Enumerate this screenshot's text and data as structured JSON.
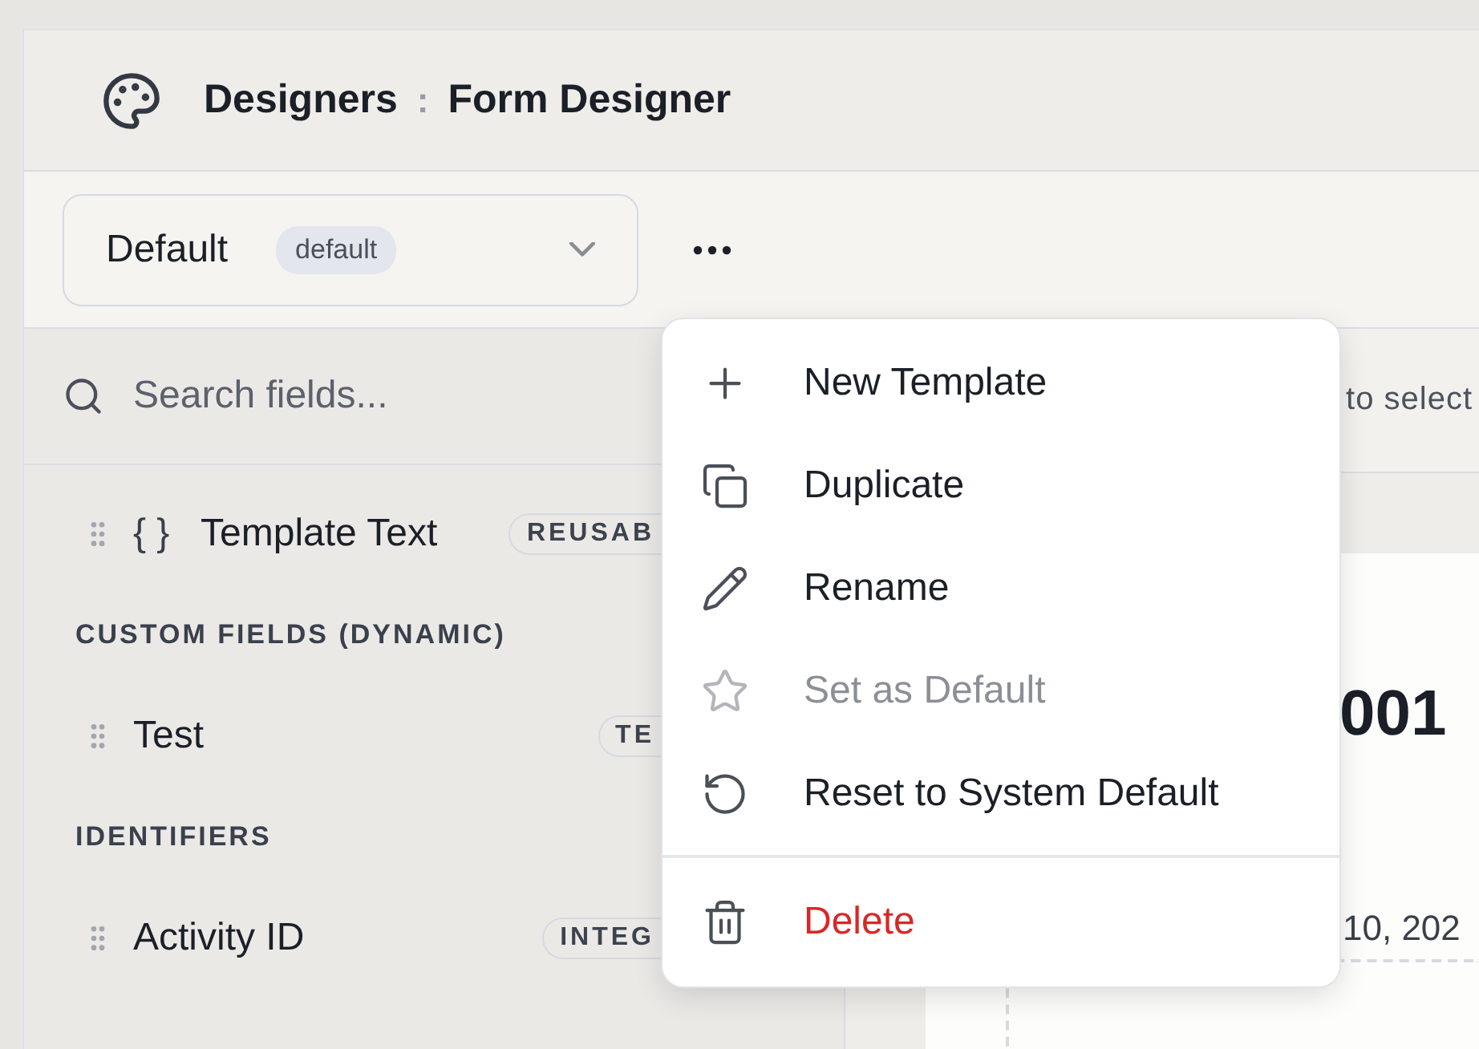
{
  "header": {
    "section": "Designers",
    "separator": ":",
    "title": "Form Designer"
  },
  "toolbar": {
    "template_select": {
      "value": "Default",
      "badge": "default"
    }
  },
  "sidebar": {
    "search": {
      "placeholder": "Search fields..."
    },
    "items": [
      {
        "kind": "field",
        "prefix": "{ }",
        "label": "Template Text",
        "type": "REUSAB"
      },
      {
        "kind": "heading",
        "label": "CUSTOM FIELDS (DYNAMIC)"
      },
      {
        "kind": "field",
        "label": "Test",
        "type": "TE"
      },
      {
        "kind": "heading",
        "label": "IDENTIFIERS"
      },
      {
        "kind": "field",
        "label": "Activity ID",
        "type": "INTEG"
      }
    ]
  },
  "canvas": {
    "hint": "to select",
    "page": {
      "title": "001",
      "date": "10, 202"
    }
  },
  "menu": {
    "items": [
      {
        "kind": "action",
        "label": "New Template",
        "disabled": false
      },
      {
        "kind": "action",
        "label": "Duplicate",
        "disabled": false
      },
      {
        "kind": "action",
        "label": "Rename",
        "disabled": false
      },
      {
        "kind": "action",
        "label": "Set as Default",
        "disabled": true
      },
      {
        "kind": "action",
        "label": "Reset to System Default",
        "disabled": false
      },
      {
        "kind": "destructive",
        "label": "Delete",
        "disabled": false
      }
    ]
  }
}
